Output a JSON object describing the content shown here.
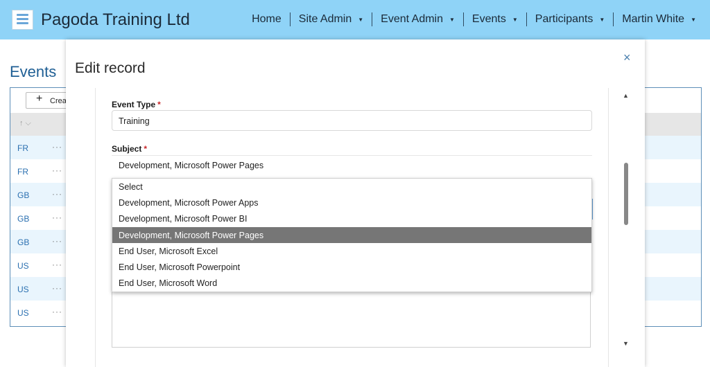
{
  "header": {
    "site_title": "Pagoda Training Ltd",
    "nav": [
      {
        "label": "Home",
        "has_caret": false
      },
      {
        "label": "Site Admin",
        "has_caret": true
      },
      {
        "label": "Event Admin",
        "has_caret": true
      },
      {
        "label": "Events",
        "has_caret": true
      },
      {
        "label": "Participants",
        "has_caret": true
      },
      {
        "label": "Martin White",
        "has_caret": true
      }
    ]
  },
  "background": {
    "page_title": "Events",
    "create_button_label": "Crea",
    "sort_icon": "sort-arrow-icon",
    "rows": [
      "FR",
      "FR",
      "GB",
      "GB",
      "GB",
      "US",
      "US",
      "US"
    ],
    "row_action": "···"
  },
  "modal": {
    "title": "Edit record",
    "close_glyph": "×",
    "fields": {
      "event_type": {
        "label": "Event Type",
        "required_marker": "*",
        "value": "Training"
      },
      "subject": {
        "label": "Subject",
        "required_marker": "*",
        "value": "Development, Microsoft Power Pages"
      }
    },
    "dropdown_options": [
      "Select",
      "Development, Microsoft Power Apps",
      "Development, Microsoft Power BI",
      "Development, Microsoft Power Pages",
      "End User, Microsoft Excel",
      "End User, Microsoft Powerpoint",
      "End User, Microsoft Word"
    ],
    "selected_option": "Development, Microsoft Power Pages"
  },
  "colors": {
    "topbar": "#8fd3f7",
    "link_blue": "#2a6fb0",
    "selected_option_bg": "#767676",
    "required_red": "#c8272a"
  }
}
